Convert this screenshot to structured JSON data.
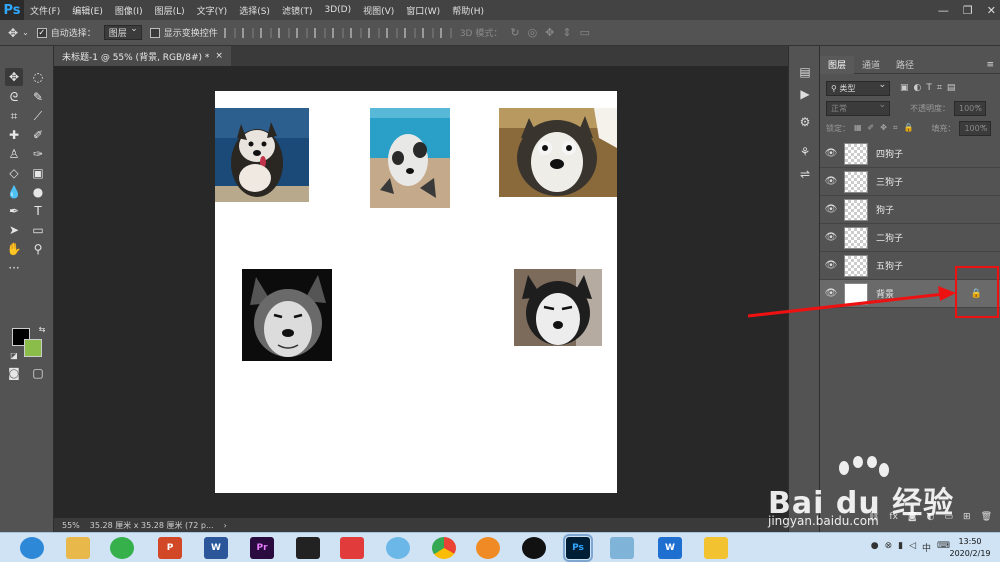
{
  "app": {
    "logo": "Ps"
  },
  "menubar": {
    "items": [
      "文件(F)",
      "编辑(E)",
      "图像(I)",
      "图层(L)",
      "文字(Y)",
      "选择(S)",
      "滤镜(T)",
      "3D(D)",
      "视图(V)",
      "窗口(W)",
      "帮助(H)"
    ]
  },
  "window_controls": {
    "minimize": "—",
    "restore": "❐",
    "close": "✕"
  },
  "options": {
    "auto_select_label": "自动选择：",
    "auto_select_checked": true,
    "auto_select_target": "图层",
    "show_transform_label": "显示变换控件",
    "show_transform_checked": false,
    "mode_3d_label": "3D 模式："
  },
  "document": {
    "tab_title": "未标题-1 @ 55% (背景, RGB/8#) *",
    "tab_close": "×",
    "zoom": "55%",
    "size": "35.28 厘米 x 35.28 厘米 (72 p...",
    "status_arrow": "›"
  },
  "colors": {
    "foreground": "#000000",
    "background": "#8bbd4a",
    "highlight": "#e11111"
  },
  "layers_panel": {
    "tabs": [
      "图层",
      "通道",
      "路径"
    ],
    "filter_kind": "类型",
    "blend_mode": "正常",
    "opacity_label": "不透明度：",
    "opacity": "100%",
    "lock_label": "锁定：",
    "fill_label": "填充：",
    "fill": "100%",
    "layers": [
      {
        "name": "四狗子",
        "visible": true
      },
      {
        "name": "三狗子",
        "visible": true
      },
      {
        "name": "狗子",
        "visible": true
      },
      {
        "name": "二狗子",
        "visible": true
      },
      {
        "name": "五狗子",
        "visible": true
      },
      {
        "name": "背景",
        "visible": true,
        "locked": true,
        "selected": true
      }
    ]
  },
  "taskbar": {
    "apps": [
      "browser-icon",
      "file-explorer-icon",
      "wechat-icon",
      "powerpoint-icon",
      "word-icon",
      "premiere-icon",
      "video-editor-icon",
      "media-player-icon",
      "chat-bubble-icon",
      "chrome-icon",
      "browser-alt-icon",
      "qq-icon",
      "photoshop-icon",
      "notes-icon",
      "wps-icon",
      "screenshot-icon"
    ],
    "app_labels": {
      "powerpoint": "P",
      "word": "W",
      "premiere": "Pr",
      "photoshop": "Ps",
      "wps": "W"
    },
    "clock_time": "13:50",
    "clock_date": "2020/2/19",
    "tray_lang": "中"
  },
  "watermark": {
    "brand": "Bai du 经验",
    "url": "jingyan.baidu.com"
  }
}
